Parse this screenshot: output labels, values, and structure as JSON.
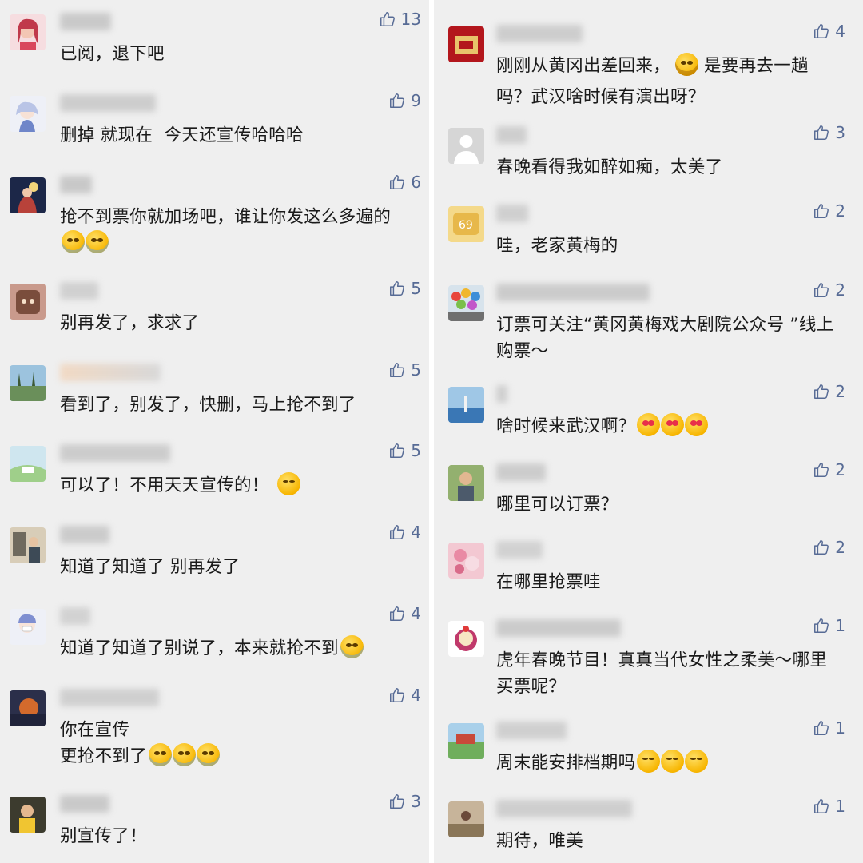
{
  "colors": {
    "background": "#efefef",
    "like_accent": "#576b95",
    "text": "#1a1a1a"
  },
  "left_column": [
    {
      "likes": "13",
      "text": "已阅，退下吧",
      "emojis": []
    },
    {
      "likes": "9",
      "text": "删掉 就现在  今天还宣传哈哈哈",
      "emojis": []
    },
    {
      "likes": "6",
      "text": "抢不到票你就加场吧，谁让你发这么多遍的",
      "emojis": [
        "crying-face",
        "crying-face"
      ]
    },
    {
      "likes": "5",
      "text": "别再发了，求求了",
      "emojis": []
    },
    {
      "likes": "5",
      "text": "看到了，别发了，快删，马上抢不到了",
      "emojis": []
    },
    {
      "likes": "5",
      "text": "可以了！不用天天宣传的！",
      "emojis": [
        "shushing-face"
      ]
    },
    {
      "likes": "4",
      "text": "知道了知道了 别再发了",
      "emojis": []
    },
    {
      "likes": "4",
      "text": "知道了知道了别说了，本来就抢不到",
      "emojis": [
        "pleading-face"
      ]
    },
    {
      "likes": "4",
      "text": "你在宣传\n更抢不到了",
      "emojis": [
        "loudly-crying-face",
        "loudly-crying-face",
        "loudly-crying-face"
      ]
    },
    {
      "likes": "3",
      "text": "别宣传了！",
      "emojis": []
    }
  ],
  "right_column": [
    {
      "likes": "4",
      "text": "刚刚从黄冈出差回来，",
      "emojis": [
        "laughing-face"
      ],
      "text_after": "是要再去一趟\n吗？武汉啥时候有演出呀？"
    },
    {
      "likes": "3",
      "text": "春晚看得我如醉如痴，太美了",
      "emojis": []
    },
    {
      "likes": "2",
      "text": "哇，老家黄梅的",
      "emojis": []
    },
    {
      "likes": "2",
      "text": "订票可关注“黄冈黄梅戏大剧院公众号 ”线上\n购票～",
      "emojis": []
    },
    {
      "likes": "2",
      "text": "啥时候来武汉啊？",
      "emojis": [
        "heart-eyes-face",
        "heart-eyes-face",
        "heart-eyes-face"
      ]
    },
    {
      "likes": "2",
      "text": "哪里可以订票？",
      "emojis": []
    },
    {
      "likes": "2",
      "text": "在哪里抢票哇",
      "emojis": []
    },
    {
      "likes": "1",
      "text": "虎年春晚节目！真真当代女性之柔美～哪里\n买票呢？",
      "emojis": []
    },
    {
      "likes": "1",
      "text": "周末能安排档期吗",
      "emojis": [
        "smiling-face",
        "smiling-face",
        "smiling-face"
      ]
    },
    {
      "likes": "1",
      "text": "期待，唯美",
      "emojis": []
    }
  ]
}
